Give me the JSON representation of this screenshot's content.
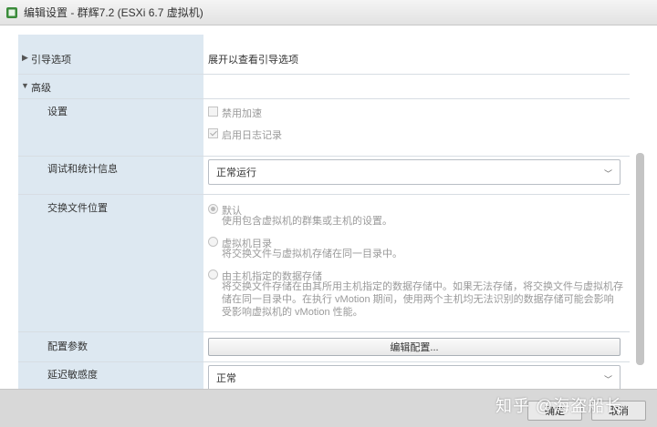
{
  "window": {
    "title": "编辑设置 - 群辉7.2 (ESXi 6.7 虚拟机)"
  },
  "sections": {
    "boot": {
      "label": "引导选项",
      "value": "展开以查看引导选项"
    },
    "advanced": {
      "label": "高级"
    }
  },
  "settings": {
    "label": "设置",
    "disable_accel": "禁用加速",
    "enable_logging": "启用日志记录"
  },
  "debug": {
    "label": "调试和统计信息",
    "selected": "正常运行"
  },
  "swap": {
    "label": "交换文件位置",
    "options": [
      {
        "title": "默认",
        "desc": "使用包含虚拟机的群集或主机的设置。"
      },
      {
        "title": "虚拟机目录",
        "desc": "将交换文件与虚拟机存储在同一目录中。"
      },
      {
        "title": "由主机指定的数据存储",
        "desc": "将交换文件存储在由其所用主机指定的数据存储中。如果无法存储，将交换文件与虚拟机存储在同一目录中。在执行 vMotion 期间，使用两个主机均无法识别的数据存储可能会影响受影响虚拟机的 vMotion 性能。"
      }
    ]
  },
  "config": {
    "label": "配置参数",
    "button": "编辑配置..."
  },
  "latency": {
    "label": "延迟敏感度",
    "selected": "正常"
  },
  "footer": {
    "ok": "确定",
    "cancel": "取消",
    "watermark": "知乎 @海盗船长"
  }
}
